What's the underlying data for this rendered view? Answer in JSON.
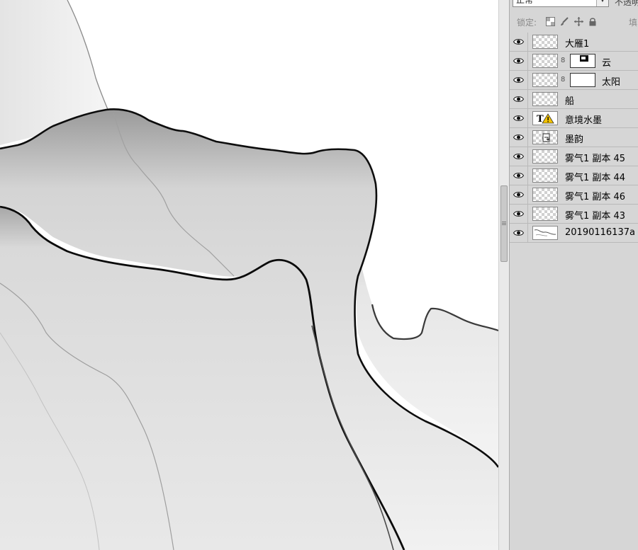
{
  "panel": {
    "blend_mode": "正常",
    "opacity_label": "不透明",
    "lock_label": "锁定:",
    "fill_label": "填",
    "lock_icons": [
      "transparent-pixels-lock-icon",
      "brush-lock-icon",
      "move-lock-icon",
      "padlock-icon"
    ]
  },
  "layers": [
    {
      "name": "大雁1",
      "thumb": "transparent",
      "mask": false
    },
    {
      "name": "云",
      "thumb": "transparent",
      "mask": true,
      "mask_content": "shape"
    },
    {
      "name": "太阳",
      "thumb": "transparent",
      "mask": true,
      "mask_content": "white"
    },
    {
      "name": "船",
      "thumb": "transparent",
      "mask": false
    },
    {
      "name": "意境水墨",
      "thumb": "type-warning",
      "mask": false
    },
    {
      "name": "墨韵",
      "thumb": "smart-object",
      "mask": false
    },
    {
      "name": "雾气1 副本 45",
      "thumb": "transparent",
      "mask": false
    },
    {
      "name": "雾气1 副本 44",
      "thumb": "transparent",
      "mask": false
    },
    {
      "name": "雾气1 副本 46",
      "thumb": "transparent",
      "mask": false
    },
    {
      "name": "雾气1 副本 43",
      "thumb": "transparent",
      "mask": false
    },
    {
      "name": "20190116137a",
      "thumb": "image",
      "mask": false
    }
  ],
  "colors": {
    "panel_bg": "#d6d6d6",
    "ink": "#111111",
    "canvas_bg": "#ffffff"
  }
}
